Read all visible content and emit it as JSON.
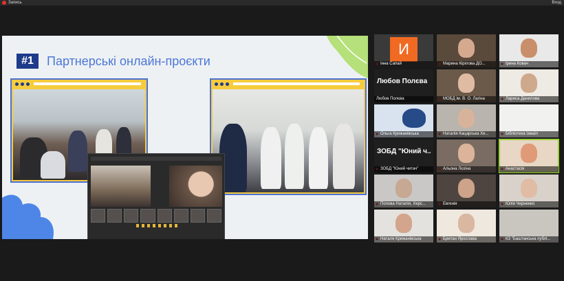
{
  "window": {
    "title": "Запись",
    "exit_label": "Вход"
  },
  "slide": {
    "badge": "#1",
    "title": "Партнерські онлайн-проєкти"
  },
  "participants": [
    {
      "name": "Інна Сапай",
      "avatar_letter": "И"
    },
    {
      "name": "Марина Кірілова ДО..."
    },
    {
      "name": "Ірина Ковач"
    },
    {
      "name": "Любов Полєва",
      "tile_text": "Любов Полєва"
    },
    {
      "name": "МОБД ім. В. О. Лагіна"
    },
    {
      "name": "Лариса Данилова"
    },
    {
      "name": "Ольга Крижанівська"
    },
    {
      "name": "Наталія Кацарська Хе..."
    },
    {
      "name": "Бібліотека Ізмаїл"
    },
    {
      "name": "ЗОБД \"Юний читач\"",
      "tile_text": "ЗОБД \"Юний ч..."
    },
    {
      "name": "Альона Лєхіна"
    },
    {
      "name": "Анастасія"
    },
    {
      "name": "Попова Наталія, Херс..."
    },
    {
      "name": "Евгенія"
    },
    {
      "name": "Юлія Черненко"
    },
    {
      "name": "Наталя Крижанівська"
    },
    {
      "name": "Британ Ярослава"
    },
    {
      "name": "КЗ \"Баштанська публі..."
    }
  ],
  "colors": {
    "accent_active": "#9bd13a",
    "muted": "#e0322c",
    "badge": "#1e3a8a"
  }
}
